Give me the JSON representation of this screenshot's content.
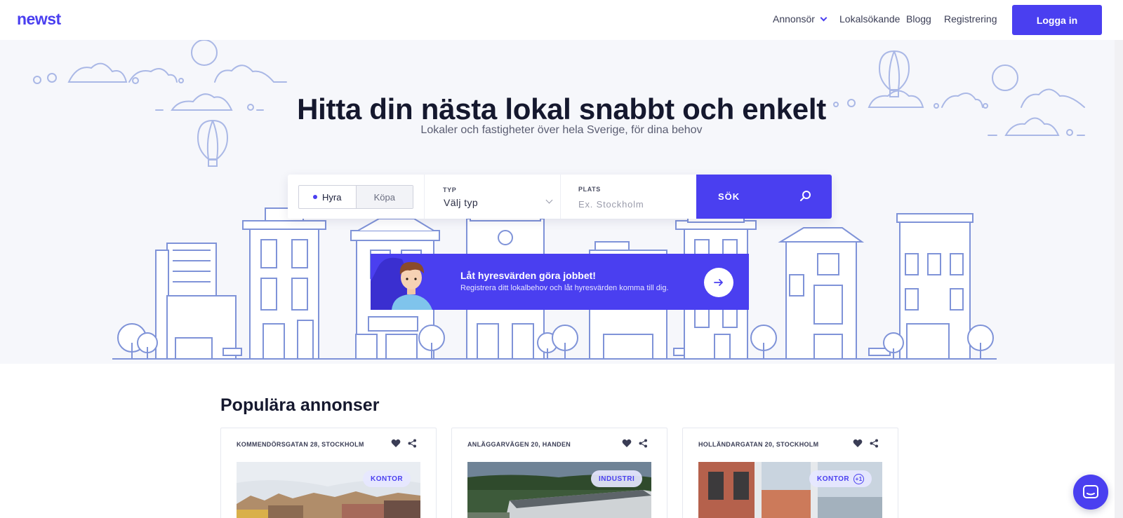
{
  "header": {
    "logo": "newst",
    "nav": [
      {
        "label": "Annonsör",
        "has_dropdown": true
      },
      {
        "label": "Lokalsökande"
      },
      {
        "label": "Blogg"
      },
      {
        "label": "Registrering"
      }
    ],
    "login_label": "Logga in"
  },
  "hero": {
    "title": "Hitta din nästa lokal snabbt och enkelt",
    "subtitle": "Lokaler och fastigheter över hela Sverige, för dina behov"
  },
  "search": {
    "modes": [
      "Hyra",
      "Köpa"
    ],
    "active_mode": "Hyra",
    "type_label": "TYP",
    "type_value": "Välj typ",
    "place_label": "PLATS",
    "place_placeholder": "Ex. Stockholm",
    "place_value": "",
    "button_label": "SÖK"
  },
  "promo": {
    "title": "Låt hyresvärden göra jobbet!",
    "text": "Registrera ditt lokalbehov och låt hyresvärden komma till dig."
  },
  "popular": {
    "title": "Populära annonser",
    "cards": [
      {
        "address": "KOMMENDÖRSGATAN 28, STOCKHOLM",
        "tag": "KONTOR",
        "extra_badge": ""
      },
      {
        "address": "ANLÄGGARVÄGEN 20, HANDEN",
        "tag": "INDUSTRI",
        "extra_badge": ""
      },
      {
        "address": "HOLLÄNDARGATAN 20, STOCKHOLM",
        "tag": "KONTOR",
        "extra_badge": "+1"
      }
    ]
  },
  "colors": {
    "brand": "#4a3ff0",
    "hero_bg": "#f6f7fb",
    "illustration": "#7f93d8"
  },
  "icons": [
    "chevron-down-icon",
    "search-icon",
    "arrow-right-icon",
    "heart-icon",
    "share-icon",
    "chat-icon"
  ]
}
